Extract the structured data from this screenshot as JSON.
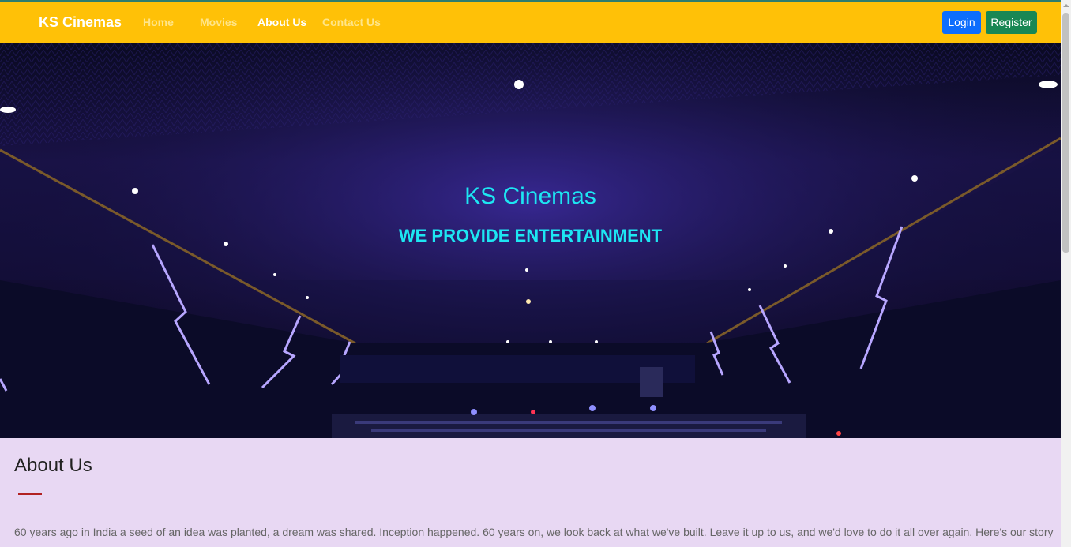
{
  "navbar": {
    "brand": "KS Cinemas",
    "links": [
      "Home",
      "Movies",
      "About Us",
      "Contact Us"
    ],
    "active_link": "About Us",
    "login_label": "Login",
    "register_label": "Register"
  },
  "hero": {
    "title": "KS Cinemas",
    "subtitle": "WE PROVIDE ENTERTAINMENT"
  },
  "about": {
    "title": "About Us",
    "text": "60 years ago in India a seed of an idea was planted, a dream was shared. Inception happened. 60 years on, we look back at what we've built. Leave it up to us, and we'd love to do it all over again. Here's our story"
  },
  "colors": {
    "navbar": "#ffc107",
    "hero_text": "#1de6f2",
    "about_background": "#e8d8f3",
    "login_button": "#0d6efd",
    "register_button": "#198754"
  }
}
